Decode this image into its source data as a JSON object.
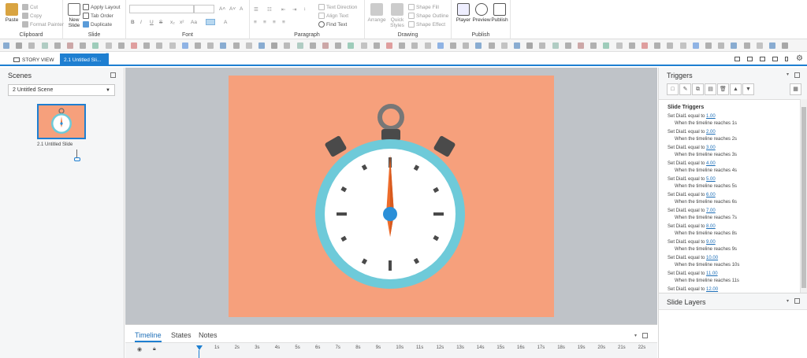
{
  "ribbon": {
    "clipboard": {
      "label": "Clipboard",
      "paste": "Paste",
      "cut": "Cut",
      "copy": "Copy",
      "format_painter": "Format Painter"
    },
    "slide": {
      "label": "Slide",
      "new_slide": "New Slide",
      "apply_layout": "Apply Layout",
      "tab_order": "Tab Order",
      "duplicate": "Duplicate"
    },
    "font": {
      "label": "Font",
      "bold": "B",
      "italic": "I",
      "underline": "U",
      "strike": "S",
      "aa": "Aa",
      "a": "A"
    },
    "paragraph": {
      "label": "Paragraph",
      "text_direction": "Text Direction",
      "align_text": "Align Text",
      "find_text": "Find Text"
    },
    "drawing": {
      "label": "Drawing",
      "arrange": "Arrange",
      "quick_styles": "Quick Styles",
      "shape_fill": "Shape Fill",
      "shape_outline": "Shape Outline",
      "shape_effect": "Shape Effect"
    },
    "publish": {
      "label": "Publish",
      "player": "Player",
      "preview": "Preview",
      "publish": "Publish"
    }
  },
  "tabs": {
    "story_view": "STORY VIEW",
    "slide_tab": "2.1 Untitled Sli...",
    "close": "×"
  },
  "scenes": {
    "title": "Scenes",
    "selected": "2 Untitled Scene",
    "thumb_label": "2.1 Untitled Slide"
  },
  "timeline": {
    "tabs": [
      "Timeline",
      "States",
      "Notes"
    ],
    "ticks": [
      "1s",
      "2s",
      "3s",
      "4s",
      "5s",
      "6s",
      "7s",
      "8s",
      "9s",
      "10s",
      "11s",
      "12s",
      "13s",
      "14s",
      "15s",
      "16s",
      "17s",
      "18s",
      "19s",
      "20s",
      "21s",
      "22s"
    ]
  },
  "triggers": {
    "title": "Triggers",
    "list_title": "Slide Triggers",
    "items": [
      {
        "action": "Set Dial1 equal to",
        "value": "1.00",
        "when": "When the timeline reaches 1s"
      },
      {
        "action": "Set Dial1 equal to",
        "value": "2.00",
        "when": "When the timeline reaches 2s"
      },
      {
        "action": "Set Dial1 equal to",
        "value": "3.00",
        "when": "When the timeline reaches 3s"
      },
      {
        "action": "Set Dial1 equal to",
        "value": "4.00",
        "when": "When the timeline reaches 4s"
      },
      {
        "action": "Set Dial1 equal to",
        "value": "5.00",
        "when": "When the timeline reaches 5s"
      },
      {
        "action": "Set Dial1 equal to",
        "value": "6.00",
        "when": "When the timeline reaches 6s"
      },
      {
        "action": "Set Dial1 equal to",
        "value": "7.00",
        "when": "When the timeline reaches 7s"
      },
      {
        "action": "Set Dial1 equal to",
        "value": "8.00",
        "when": "When the timeline reaches 8s"
      },
      {
        "action": "Set Dial1 equal to",
        "value": "9.00",
        "when": "When the timeline reaches 9s"
      },
      {
        "action": "Set Dial1 equal to",
        "value": "10.00",
        "when": "When the timeline reaches 10s"
      },
      {
        "action": "Set Dial1 equal to",
        "value": "11.00",
        "when": "When the timeline reaches 11s"
      },
      {
        "action": "Set Dial1 equal to",
        "value": "12.00",
        "when": "When the timeline reaches 12s"
      }
    ],
    "layers_title": "Slide Layers"
  },
  "colors": {
    "accent": "#1e7fd1",
    "slide_bg": "#f6a07c",
    "dial_ring": "#6ecad9",
    "needle": "#ee6c2b"
  }
}
